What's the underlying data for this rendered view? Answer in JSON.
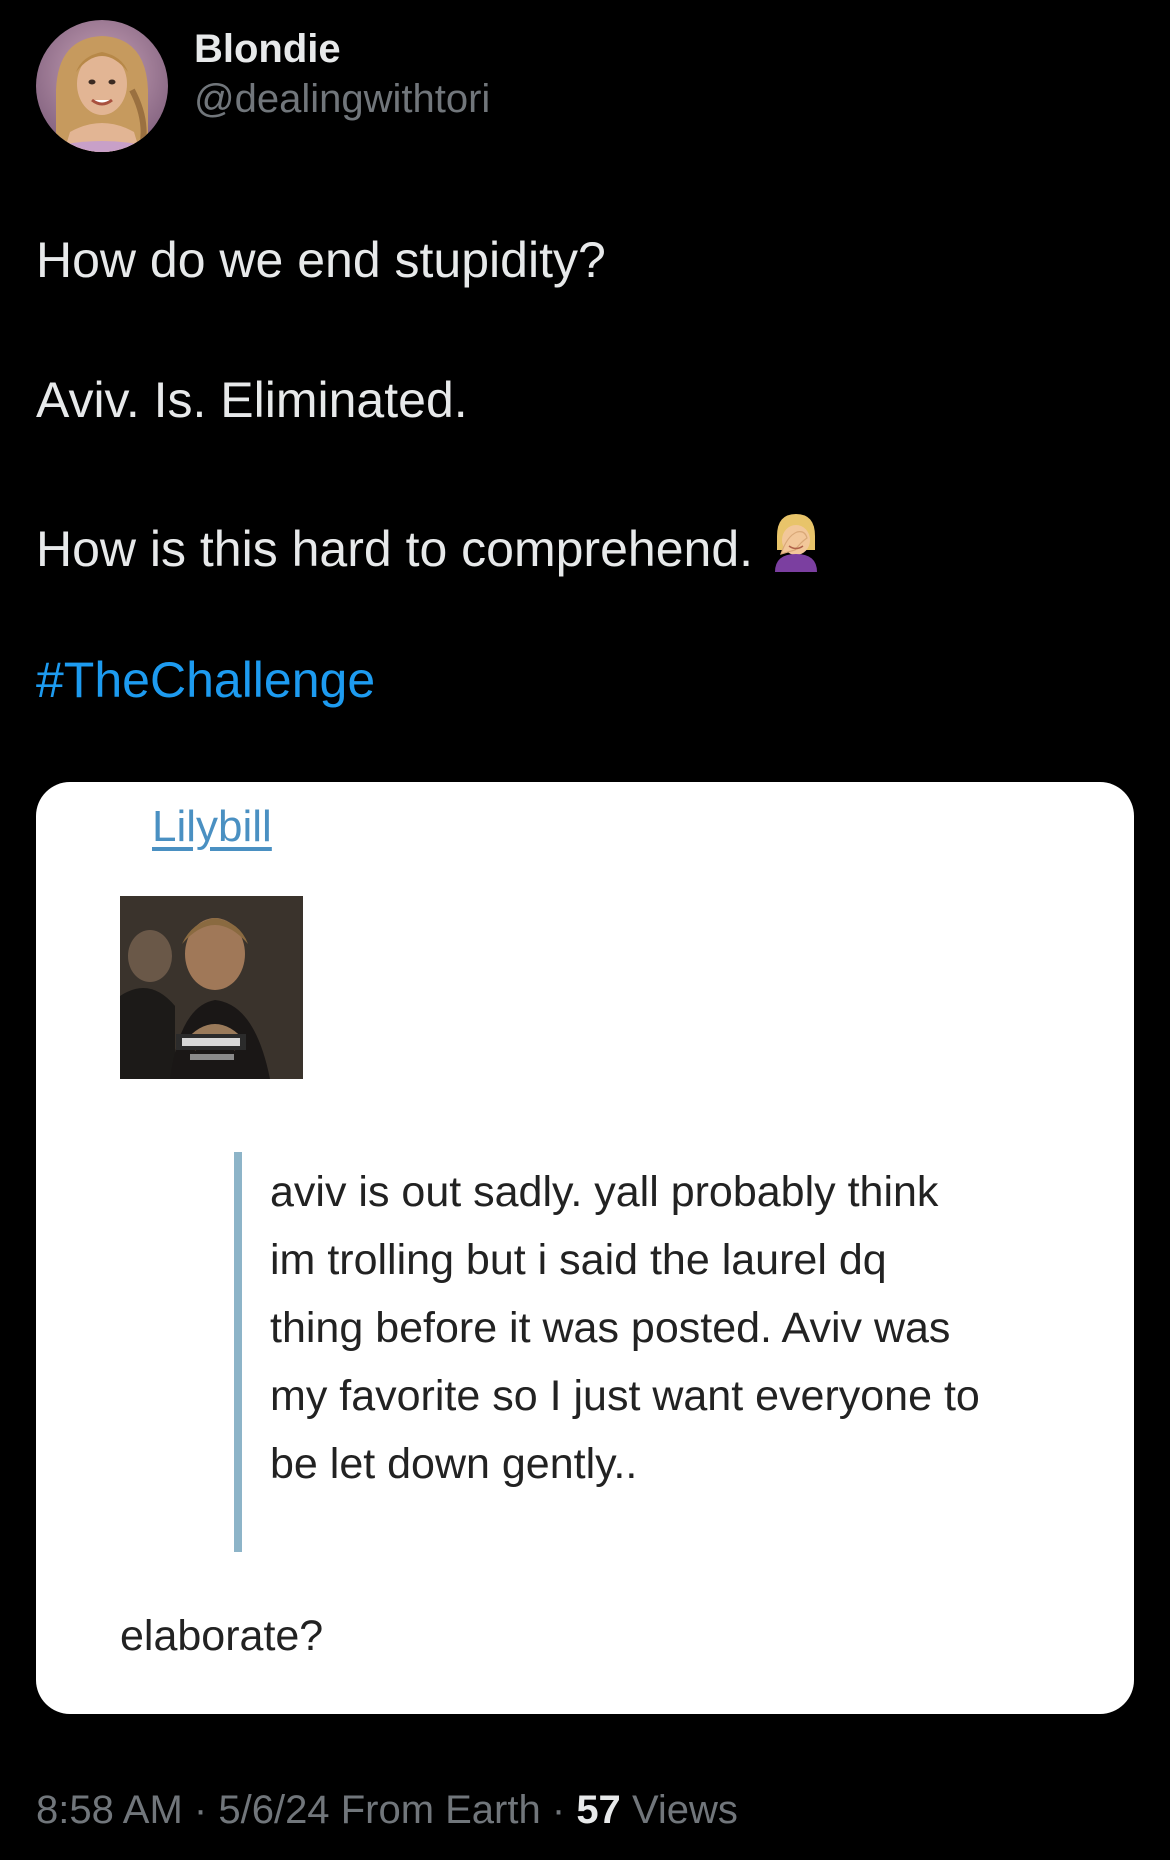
{
  "author": {
    "display_name": "Blondie",
    "handle": "@dealingwithtori"
  },
  "tweet": {
    "line1": "How do we end stupidity?",
    "line2": "Aviv. Is. Eliminated.",
    "line3": "How is this hard to comprehend.",
    "line3_emoji": "woman-facepalming-icon",
    "hashtag": "#TheChallenge"
  },
  "embed": {
    "author": "Lilybill",
    "quote": "aviv is out sadly. yall probably think im trolling but i said the laurel dq thing before it was posted. Aviv was my favorite so I just want everyone to be let down gently..",
    "reply": "elaborate?"
  },
  "meta": {
    "time": "8:58 AM",
    "date": "5/6/24",
    "location": "From Earth",
    "views_count": "57",
    "views_label": "Views",
    "separator": "·"
  },
  "colors": {
    "background": "#000000",
    "text": "#e7e9ea",
    "muted": "#71767b",
    "link": "#1d9bf0",
    "card_link": "#4a90c2",
    "quote_bar": "#8db4c8"
  }
}
